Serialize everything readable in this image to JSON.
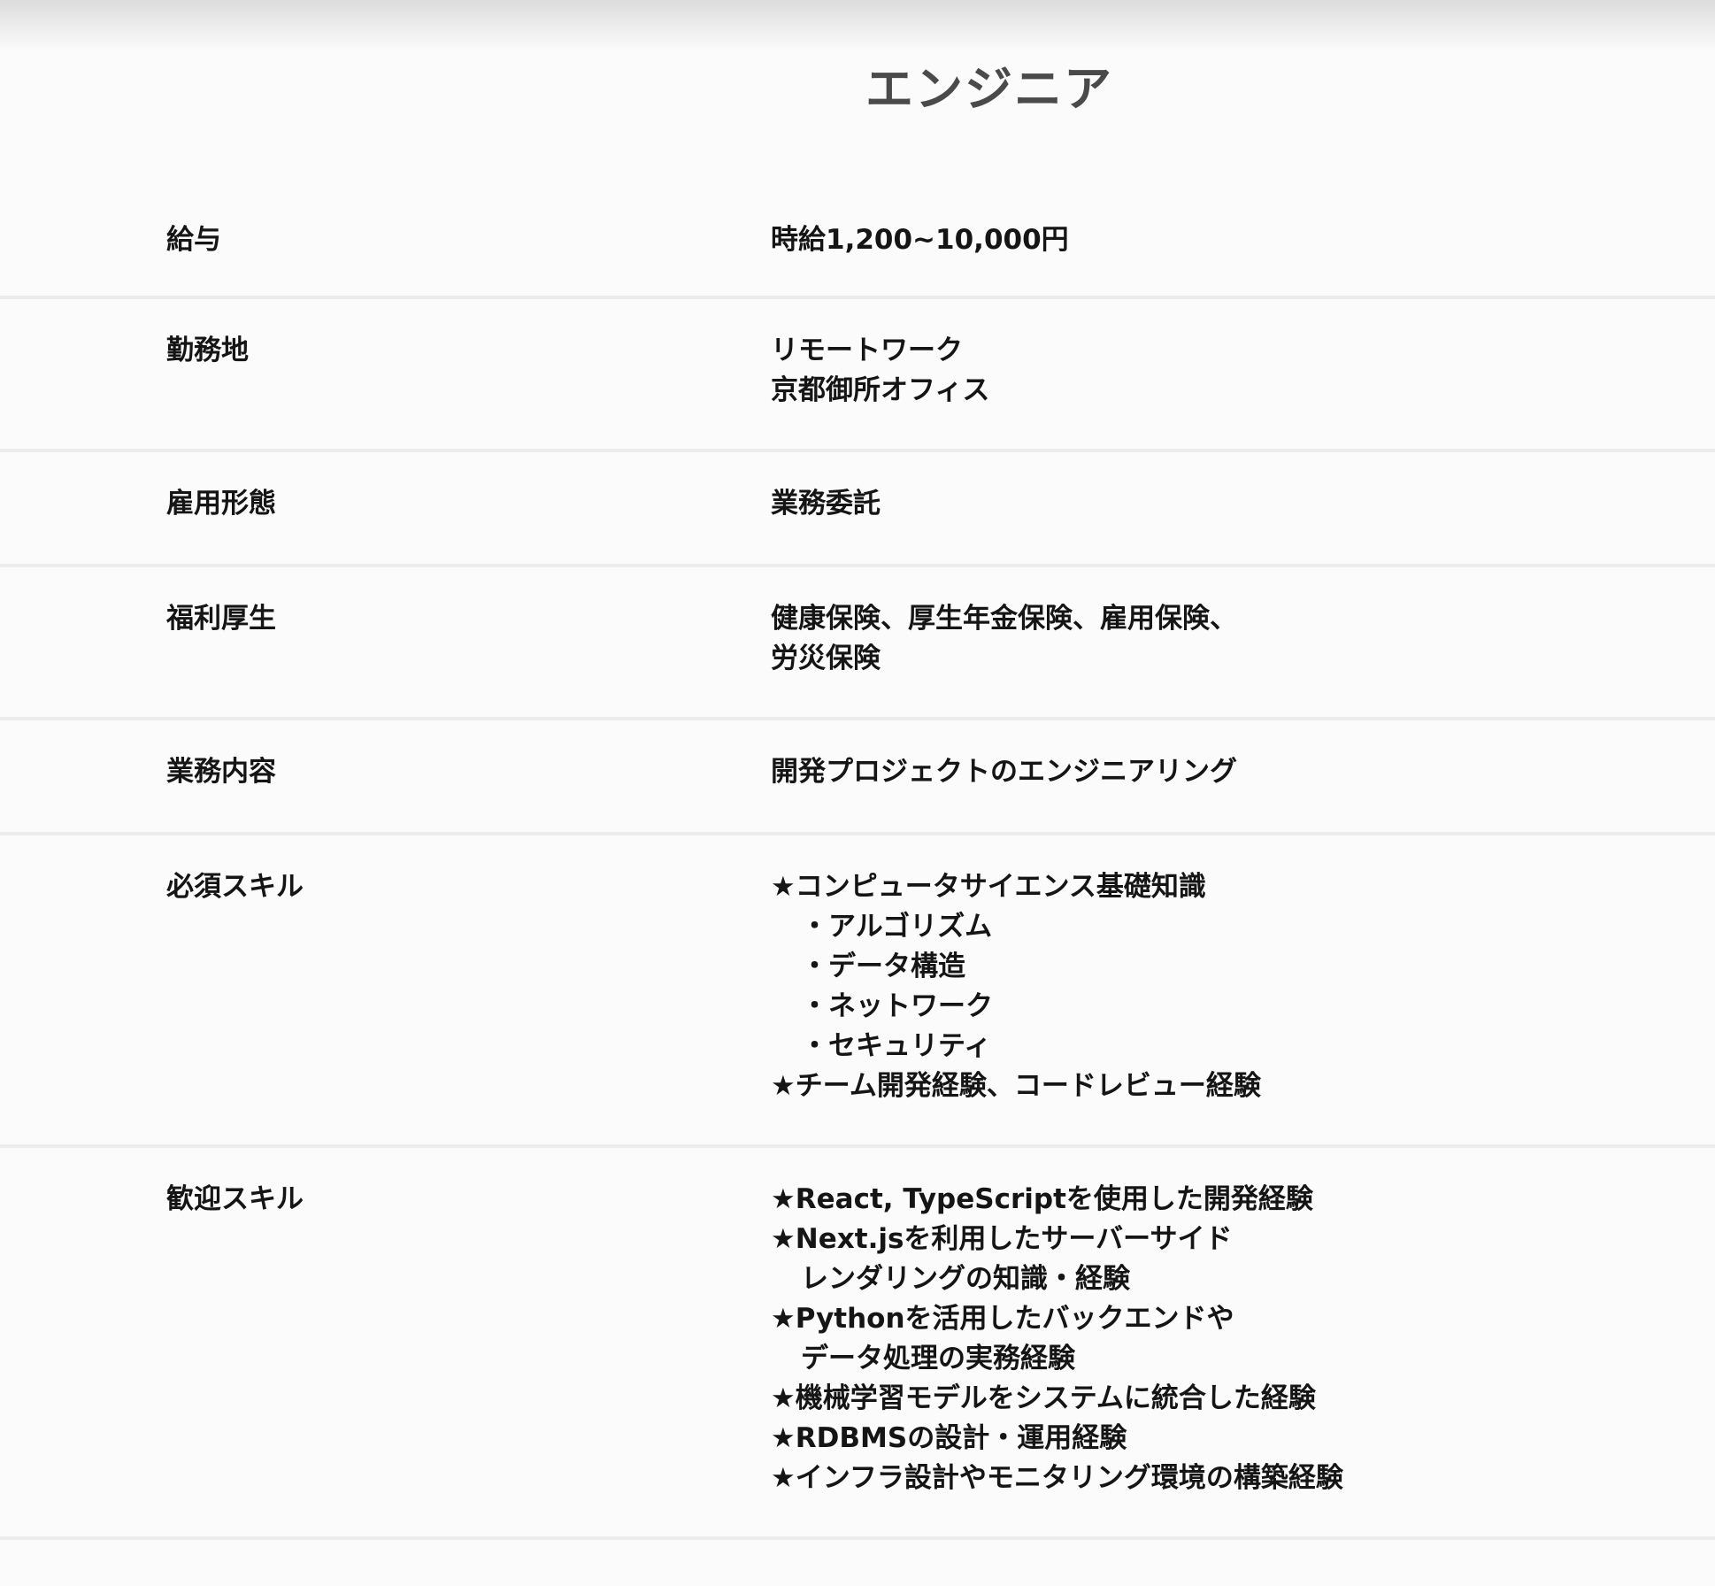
{
  "title": "エンジニア",
  "rows": [
    {
      "label": "給与",
      "lines": [
        "時給1,200~10,000円"
      ]
    },
    {
      "label": "勤務地",
      "lines": [
        "リモートワーク",
        "京都御所オフィス"
      ]
    },
    {
      "label": "雇用形態",
      "lines": [
        "業務委託"
      ]
    },
    {
      "label": "福利厚生",
      "lines": [
        "健康保険、厚生年金保険、雇用保険、",
        "労災保険"
      ]
    },
    {
      "label": "業務内容",
      "lines": [
        "開発プロジェクトのエンジニアリング"
      ]
    },
    {
      "label": "必須スキル",
      "lines": [
        "★コンピュータサイエンス基礎知識",
        "・アルゴリズム",
        "・データ構造",
        "・ネットワーク",
        "・セキュリティ",
        "★チーム開発経験、コードレビュー経験"
      ]
    },
    {
      "label": "歓迎スキル",
      "lines": [
        "★React, TypeScriptを使用した開発経験",
        "★Next.jsを利用したサーバーサイド",
        "レンダリングの知識・経験",
        "★Pythonを活用したバックエンドや",
        "データ処理の実務経験",
        "★機械学習モデルをシステムに統合した経験",
        "★RDBMSの設計・運用経験",
        "★インフラ設計やモニタリング環境の構築経験"
      ]
    }
  ]
}
